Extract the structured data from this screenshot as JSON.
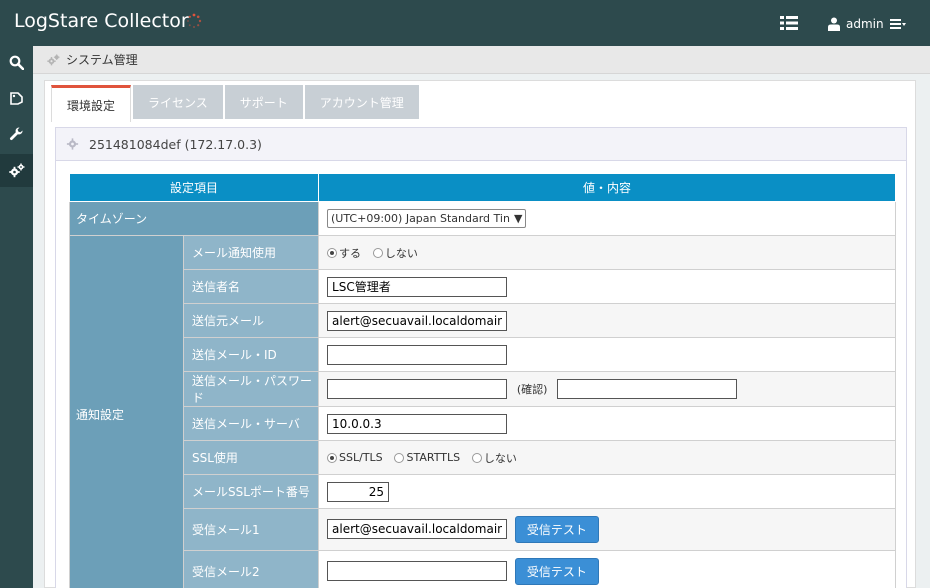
{
  "header": {
    "brand": "LogStare Collector",
    "user": "admin",
    "icons": {
      "spinner": "loading-spinner-icon",
      "list": "list-icon",
      "user": "user-icon",
      "menu": "menu-icon"
    }
  },
  "sidebar": {
    "items": [
      {
        "icon": "search-icon"
      },
      {
        "icon": "tags-icon"
      },
      {
        "icon": "wrench-icon"
      },
      {
        "icon": "gears-icon"
      }
    ]
  },
  "breadcrumb": {
    "text": "システム管理",
    "icon": "gears-icon"
  },
  "tabs": [
    {
      "label": "環境設定",
      "active": true
    },
    {
      "label": "ライセンス",
      "active": false
    },
    {
      "label": "サポート",
      "active": false
    },
    {
      "label": "アカウント管理",
      "active": false
    }
  ],
  "panel": {
    "host": "251481084def (172.17.0.3)"
  },
  "table": {
    "col_item": "設定項目",
    "col_value": "値・内容",
    "timezone_label": "タイムゾーン",
    "timezone_value": "(UTC+09:00) Japan Standard Tin",
    "group_label": "通知設定",
    "rows": {
      "mail_use": {
        "label": "メール通知使用",
        "options": [
          "する",
          "しない"
        ],
        "selected": "する"
      },
      "sender_name": {
        "label": "送信者名",
        "value": "LSC管理者"
      },
      "sender_mail": {
        "label": "送信元メール",
        "value": "alert@secuavail.localdomain"
      },
      "smtp_id": {
        "label": "送信メール・ID",
        "value": ""
      },
      "smtp_password": {
        "label": "送信メール・パスワード",
        "value": "",
        "confirm_label": "(確認)",
        "confirm_value": ""
      },
      "smtp_server": {
        "label": "送信メール・サーバ",
        "value": "10.0.0.3"
      },
      "ssl": {
        "label": "SSL使用",
        "options": [
          "SSL/TLS",
          "STARTTLS",
          "しない"
        ],
        "selected": "SSL/TLS"
      },
      "ssl_port": {
        "label": "メールSSLポート番号",
        "value": "25"
      },
      "recv1": {
        "label": "受信メール1",
        "value": "alert@secuavail.localdomain",
        "button": "受信テスト"
      },
      "recv2": {
        "label": "受信メール2",
        "value": "",
        "button": "受信テスト"
      }
    }
  },
  "colors": {
    "header": "#2d4a4d",
    "table_head": "#0a8fc5",
    "category": "#6c9fb8",
    "subcategory": "#8fb5c9",
    "button": "#3b8fd6",
    "tab_accent": "#e0533c"
  }
}
